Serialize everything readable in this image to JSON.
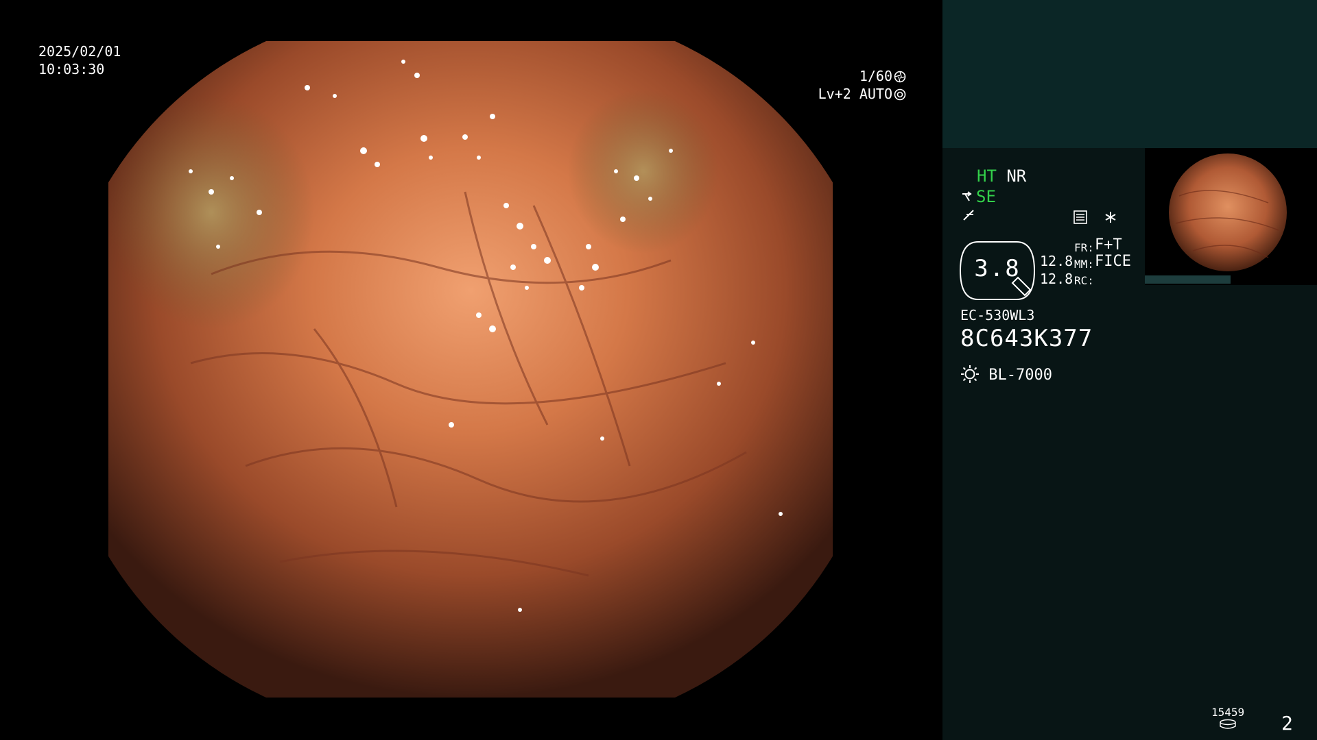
{
  "osd": {
    "date": "2025/02/01",
    "time": "10:03:30",
    "shutter": "1/60",
    "level": "Lv+2 AUTO"
  },
  "panel": {
    "ht": "HT",
    "nr": "NR",
    "se": "SE",
    "param_value": "3.8",
    "num1": "12.8",
    "num2": "12.8",
    "fr_label": "FR:",
    "fr_value": "F+T",
    "mm_label": "MM:",
    "mm_value": "FICE",
    "rc_label": "RC:",
    "scope_model": "EC-530WL3",
    "scope_serial": "8C643K377",
    "light_source": "BL-7000",
    "counter": "15459",
    "page_number": "2"
  },
  "colors": {
    "panel_bg": "#081515",
    "panel_top_bg": "#0b2626",
    "accent_green": "#33d14a",
    "tissue": "#c8683f"
  },
  "icons": [
    "aperture-icon",
    "iris-icon",
    "scope-tip-icon",
    "f-curve-icon",
    "menu-list-icon",
    "asterisk-icon",
    "light-source-icon",
    "disk-icon"
  ]
}
